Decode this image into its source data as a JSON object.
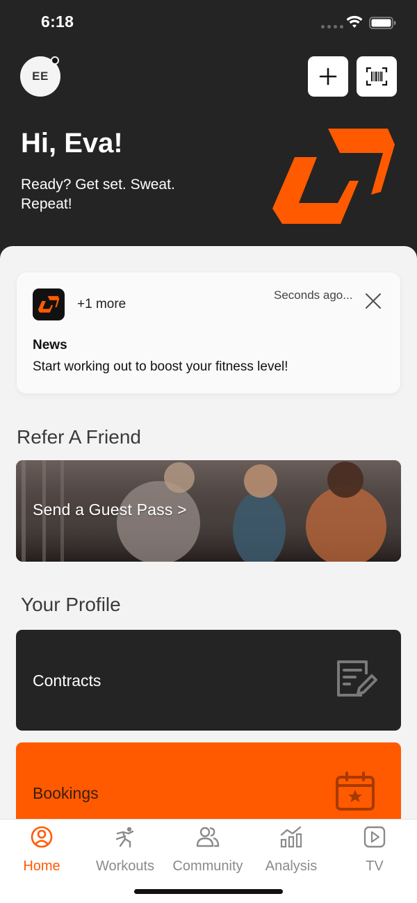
{
  "status_bar": {
    "time": "6:18"
  },
  "header": {
    "avatar_initials": "EE",
    "greeting": "Hi, Eva!",
    "tagline": "Ready? Get set. Sweat. Repeat!"
  },
  "notification": {
    "more_label": "+1 more",
    "time": "Seconds ago...",
    "title": "News",
    "body": "Start working out to boost your fitness level!"
  },
  "refer": {
    "section_title": "Refer A Friend",
    "guest_pass_label": "Send a Guest Pass >"
  },
  "profile": {
    "section_title": "Your Profile",
    "contracts_label": "Contracts",
    "bookings_label": "Bookings"
  },
  "tabbar": {
    "tabs": [
      {
        "label": "Home",
        "icon": "user-circle-icon",
        "active": true
      },
      {
        "label": "Workouts",
        "icon": "runner-icon",
        "active": false
      },
      {
        "label": "Community",
        "icon": "people-icon",
        "active": false
      },
      {
        "label": "Analysis",
        "icon": "chart-icon",
        "active": false
      },
      {
        "label": "TV",
        "icon": "play-icon",
        "active": false
      }
    ]
  },
  "colors": {
    "accent": "#ff5a00",
    "header_bg": "#242424",
    "sheet_bg": "#f3f3f3",
    "inactive_tab": "#8a8a8a"
  }
}
